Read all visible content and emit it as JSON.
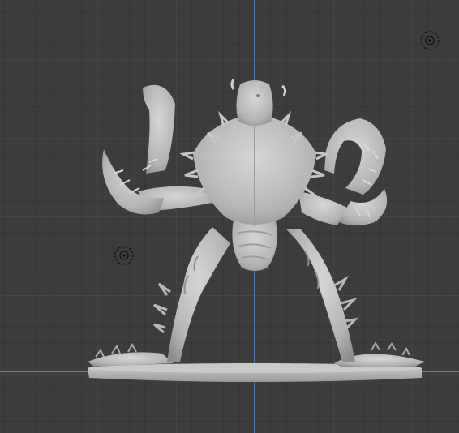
{
  "viewport": {
    "mode": "3d-viewport-front-orthographic",
    "object": "crab-creature-miniature",
    "colors": {
      "background": "#3d3d3d",
      "grid_line": "#4a4a4a",
      "x_axis": "#6a8f36",
      "z_axis": "#4f77b0",
      "model_base": "#bdbdbd",
      "model_shadow": "#8f8f8f",
      "model_highlight": "#d2d2d2"
    },
    "icons": {
      "empty_object_marker": "empty-object-icon"
    }
  }
}
